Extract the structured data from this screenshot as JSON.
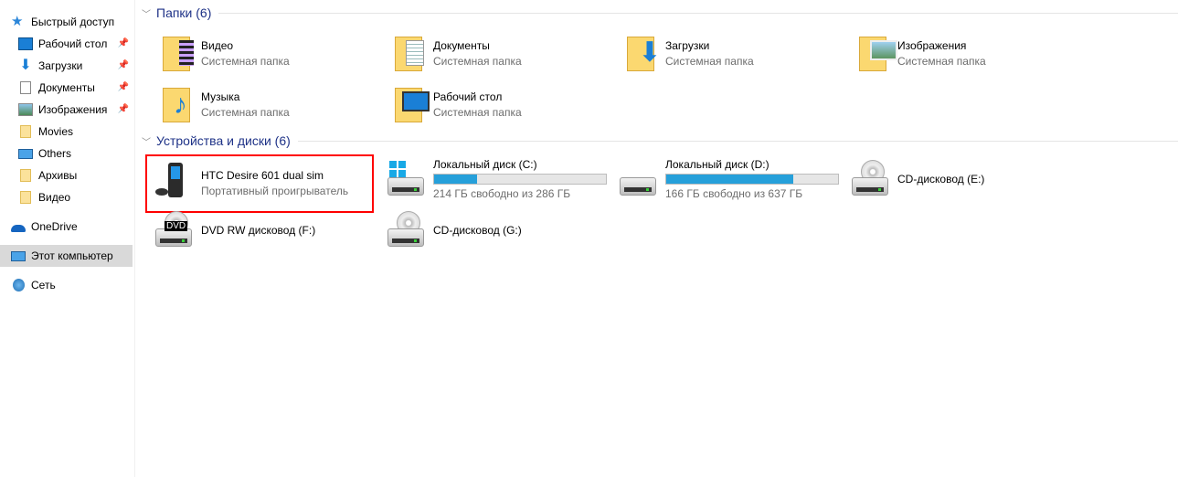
{
  "sidebar": {
    "items": [
      {
        "label": "Быстрый доступ",
        "icon": "quick-access-star-icon"
      },
      {
        "label": "Рабочий стол",
        "icon": "desktop-icon",
        "pinned": true
      },
      {
        "label": "Загрузки",
        "icon": "downloads-icon",
        "pinned": true
      },
      {
        "label": "Документы",
        "icon": "documents-icon",
        "pinned": true
      },
      {
        "label": "Изображения",
        "icon": "pictures-icon",
        "pinned": true
      },
      {
        "label": "Movies",
        "icon": "folder-icon"
      },
      {
        "label": "Others",
        "icon": "network-drive-icon"
      },
      {
        "label": "Архивы",
        "icon": "folder-icon"
      },
      {
        "label": "Видео",
        "icon": "folder-icon"
      },
      {
        "label": "OneDrive",
        "icon": "onedrive-icon"
      },
      {
        "label": "Этот компьютер",
        "icon": "this-pc-icon",
        "selected": true
      },
      {
        "label": "Сеть",
        "icon": "network-icon"
      }
    ],
    "pin_glyph": "📌"
  },
  "folders": {
    "title": "Папки (6)",
    "items": [
      {
        "name": "Видео",
        "sub": "Системная папка"
      },
      {
        "name": "Документы",
        "sub": "Системная папка"
      },
      {
        "name": "Загрузки",
        "sub": "Системная папка"
      },
      {
        "name": "Изображения",
        "sub": "Системная папка"
      },
      {
        "name": "Музыка",
        "sub": "Системная папка"
      },
      {
        "name": "Рабочий стол",
        "sub": "Системная папка"
      }
    ]
  },
  "devices": {
    "title": "Устройства и диски (6)",
    "items": [
      {
        "name": "HTC Desire 601 dual sim",
        "sub": "Портативный проигрыватель",
        "highlighted": true
      },
      {
        "name": "Локальный диск (C:)",
        "sub": "214 ГБ свободно из 286 ГБ",
        "used_fraction": 0.25
      },
      {
        "name": "Локальный диск (D:)",
        "sub": "166 ГБ свободно из 637 ГБ",
        "used_fraction": 0.74
      },
      {
        "name": "CD-дисковод (E:)"
      },
      {
        "name": "DVD RW дисковод (F:)",
        "badge": "DVD"
      },
      {
        "name": "CD-дисковод (G:)"
      }
    ]
  },
  "colors": {
    "accent": "#26a0da",
    "section_title": "#1e3287",
    "highlight": "#ff0000"
  }
}
